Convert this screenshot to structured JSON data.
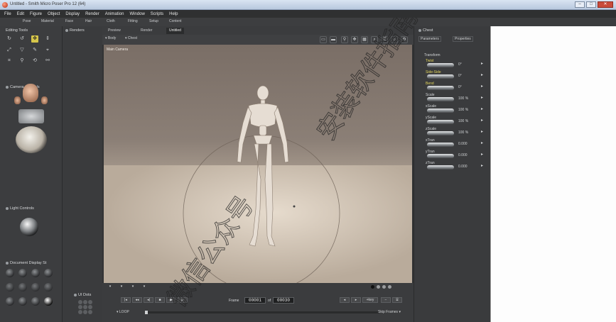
{
  "window": {
    "title": "Untitled - Smith Micro Poser Pro 12 (64)",
    "buttons": {
      "minimize": "–",
      "maximize": "□",
      "close": "✕"
    }
  },
  "menu": [
    "File",
    "Edit",
    "Figure",
    "Object",
    "Display",
    "Render",
    "Animation",
    "Window",
    "Scripts",
    "Help"
  ],
  "room_tabs": [
    "Pose",
    "Material",
    "Face",
    "Hair",
    "Cloth",
    "Fitting",
    "Setup",
    "Content"
  ],
  "left_panel": {
    "editing_tools_label": "Editing Tools",
    "camera_controls_label": "Camera Controls",
    "light_controls_label": "Light Controls",
    "document_display_label": "Document Display St"
  },
  "render_label": "Renders",
  "doc_tabs": {
    "preview": "Preview",
    "render": "Render",
    "untitled": "Untitled"
  },
  "view_options": {
    "figure_label": "Body",
    "object_label": "Chest"
  },
  "viewport": {
    "camera_label": "Main Camera"
  },
  "playback": {
    "frame_label": "Frame",
    "current_frame": "00001",
    "total_frames": "00030",
    "loop_label": "LOOP",
    "step_label": "Skip Frames",
    "ui_dots_label": "UI Dots"
  },
  "right_panel": {
    "header": "Chest",
    "tabs": {
      "parameters": "Parameters",
      "properties": "Properties"
    },
    "section": "Transform",
    "params": [
      {
        "name": "Twist",
        "value": "0°",
        "highlight": true
      },
      {
        "name": "Side-Side",
        "value": "0°",
        "highlight": true
      },
      {
        "name": "Bend",
        "value": "0°",
        "highlight": true
      },
      {
        "name": "Scale",
        "value": "100 %",
        "highlight": false
      },
      {
        "name": "xScale",
        "value": "100 %",
        "highlight": false
      },
      {
        "name": "yScale",
        "value": "100 %",
        "highlight": false
      },
      {
        "name": "zScale",
        "value": "100 %",
        "highlight": false
      },
      {
        "name": "xTran",
        "value": "0.000",
        "highlight": false
      },
      {
        "name": "yTran",
        "value": "0.000",
        "highlight": false
      },
      {
        "name": "zTran",
        "value": "0.000",
        "highlight": false
      }
    ]
  },
  "watermark": {
    "line1": "安装软件指南",
    "line2": "微信公众号"
  }
}
